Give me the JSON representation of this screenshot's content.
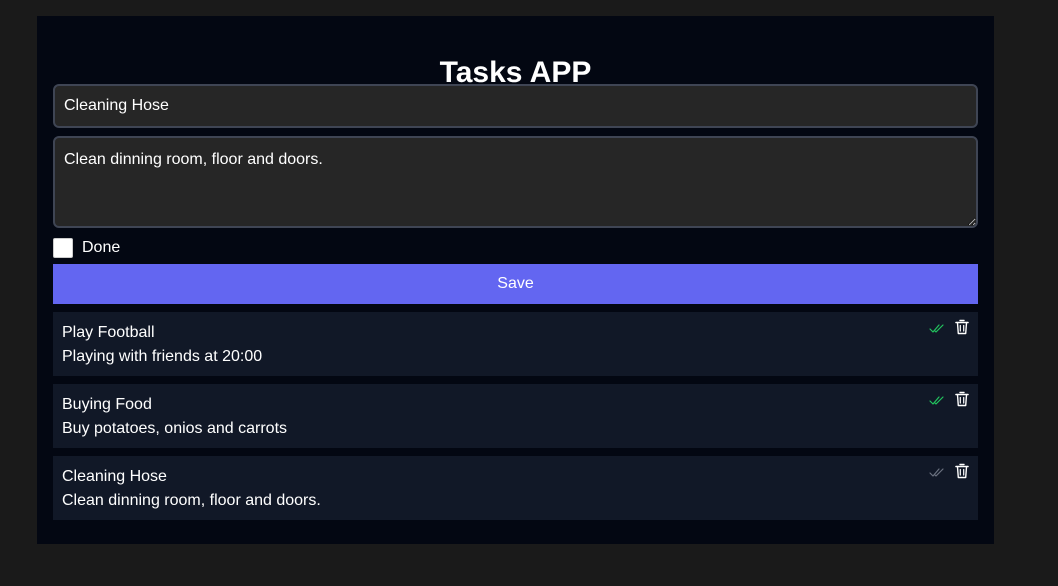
{
  "app": {
    "title": "Tasks APP"
  },
  "form": {
    "title_value": "Cleaning Hose",
    "description_value": "Clean dinning room, floor and doors.",
    "done_label": "Done",
    "done_checked": false,
    "save_label": "Save"
  },
  "colors": {
    "accent": "#6366f1",
    "done_check": "#22c55e",
    "pending_check": "#6b7280",
    "card_background": "#111827",
    "app_background": "#030712"
  },
  "tasks": [
    {
      "title": "Play Football",
      "description": "Playing with friends at 20:00",
      "done": true,
      "status_icon": "double-check-icon",
      "delete_icon": "trash-icon"
    },
    {
      "title": "Buying Food",
      "description": "Buy potatoes, onios and carrots",
      "done": true,
      "status_icon": "double-check-icon",
      "delete_icon": "trash-icon"
    },
    {
      "title": "Cleaning Hose",
      "description": "Clean dinning room, floor and doors.",
      "done": false,
      "status_icon": "double-check-icon",
      "delete_icon": "trash-icon"
    }
  ]
}
